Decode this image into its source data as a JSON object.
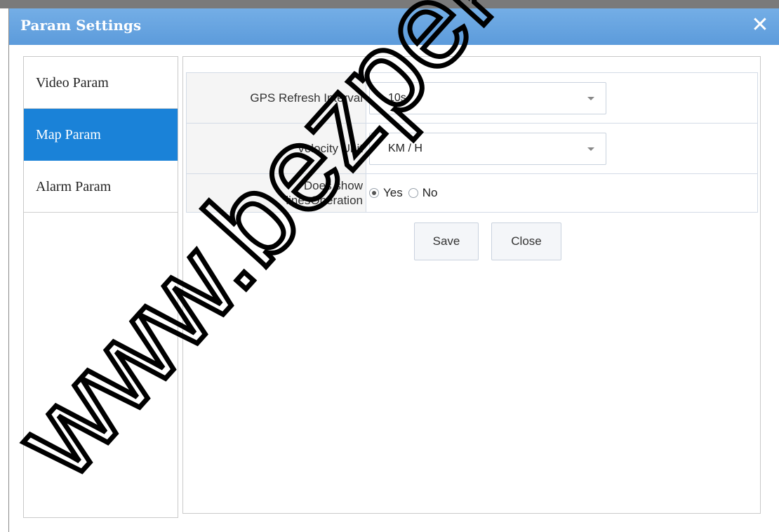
{
  "dialog": {
    "title": "Param Settings",
    "close_symbol": "✕"
  },
  "sidebar": {
    "items": [
      {
        "label": "Video Param",
        "active": false
      },
      {
        "label": "Map Param",
        "active": true
      },
      {
        "label": "Alarm Param",
        "active": false
      }
    ]
  },
  "form": {
    "gps_refresh": {
      "label": "GPS Refresh Interval",
      "value": "10s"
    },
    "velocity_unit": {
      "label": "Velocity Unit",
      "value": "KM / H"
    },
    "show_lines": {
      "label_line1": "Does show",
      "label_line2": "linesOperation",
      "options": [
        {
          "label": "Yes",
          "checked": true
        },
        {
          "label": "No",
          "checked": false
        }
      ]
    }
  },
  "actions": {
    "save_label": "Save",
    "close_label": "Close"
  },
  "watermark": {
    "text": "www.bezpeka."
  },
  "colors": {
    "titlebar": "#6aa6e2",
    "active_item": "#1a82d8"
  },
  "icons": {
    "close": "close-icon",
    "dropdown": "chevron-down-icon"
  }
}
